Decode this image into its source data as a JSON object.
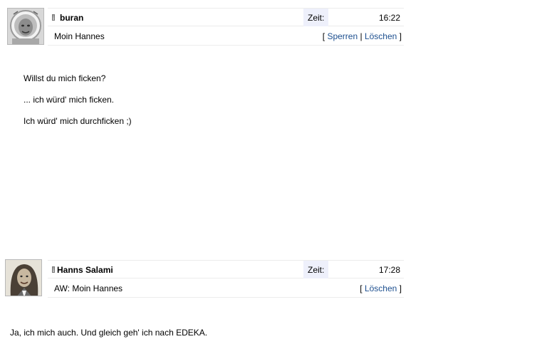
{
  "messages": [
    {
      "username": "buran",
      "time_label": "Zeit:",
      "time": "16:22",
      "subject": "Moin Hannes",
      "actions": {
        "open": "[ ",
        "sperren": "Sperren",
        "sep": " | ",
        "loeschen": "Löschen",
        "close": " ]"
      },
      "body_lines": [
        "Willst du mich ficken?",
        "... ich würd' mich ficken.",
        "Ich würd' mich durchficken ;)"
      ],
      "avatar_icon": "astronaut-portrait"
    },
    {
      "username": "Hanns Salami",
      "time_label": "Zeit:",
      "time": "17:28",
      "subject": "AW: Moin Hannes",
      "actions": {
        "open": "[ ",
        "loeschen": "Löschen",
        "close": " ]"
      },
      "body_lines": [
        "Ja, ich mich auch. Und gleich geh' ich nach EDEKA."
      ],
      "avatar_icon": "long-hair-portrait"
    }
  ]
}
